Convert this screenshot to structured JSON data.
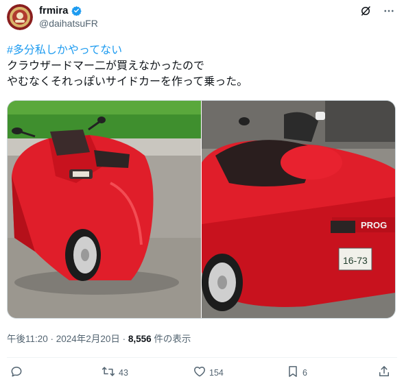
{
  "user": {
    "display_name": "frmira",
    "handle": "@daihatsuFR",
    "verified": true
  },
  "tweet": {
    "hashtag": "#多分私しかやってない",
    "line1": "クラウザードマー二が買えなかったので",
    "line2": "やむなくそれっぽいサイドカーを作って乗った。"
  },
  "media": [
    {
      "description_icon": "car-photo-front",
      "plate_text": ""
    },
    {
      "description_icon": "car-photo-rear",
      "brand_text": "PROG",
      "plate_text": "16-73"
    }
  ],
  "meta": {
    "timestamp": "午後11:20 · 2024年2月20日 · ",
    "views": "8,556",
    "views_label": " 件の表示"
  },
  "actions": {
    "reply_count": "",
    "retweet_count": "43",
    "like_count": "154",
    "bookmark_count": "6"
  },
  "colors": {
    "accent": "#1d9bf0",
    "text": "#0f1419",
    "secondary": "#536471",
    "car_red": "#e01e2a"
  }
}
